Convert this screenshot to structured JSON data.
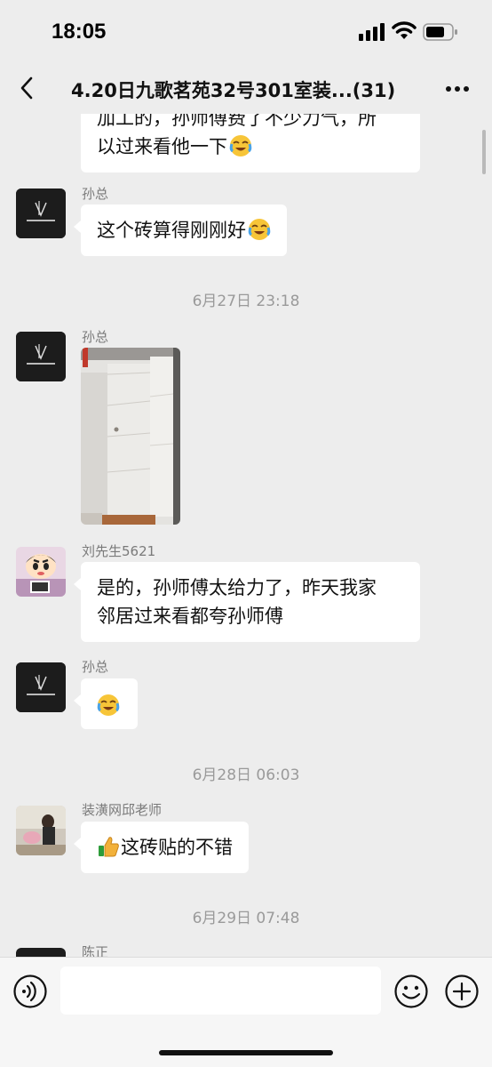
{
  "status_bar": {
    "time": "18:05",
    "icons": [
      "signal-icon",
      "wifi-icon",
      "battery-icon"
    ]
  },
  "nav": {
    "back_icon": "chevron-left-icon",
    "title": "4.20日九歌茗苑32号301室装...(31)",
    "more_icon": "more-dots-icon"
  },
  "messages": [
    {
      "type": "text",
      "sender": "",
      "lines": [
        "加工的，孙师傅费了不少力气，所",
        "以过来看他一下"
      ],
      "emoji": "crying-laughing"
    },
    {
      "type": "text",
      "sender": "孙总",
      "avatar": "company-logo-avatar",
      "lines": [
        "这个砖算得刚刚好"
      ],
      "emoji": "crying-laughing"
    },
    {
      "type": "timestamp",
      "text": "6月27日 23:18"
    },
    {
      "type": "image",
      "sender": "孙总",
      "avatar": "company-logo-avatar",
      "image": "bathroom-tile-photo"
    },
    {
      "type": "text",
      "sender": "刘先生5621",
      "avatar": "cartoon-avatar",
      "lines": [
        "是的，孙师傅太给力了，昨天我家",
        "邻居过来看都夸孙师傅"
      ]
    },
    {
      "type": "text",
      "sender": "孙总",
      "avatar": "company-logo-avatar",
      "lines": [
        ""
      ],
      "emoji": "crying-laughing"
    },
    {
      "type": "timestamp",
      "text": "6月28日 06:03"
    },
    {
      "type": "text",
      "sender": "装潢网邱老师",
      "avatar": "photo-avatar",
      "lines": [
        "这砖贴的不错"
      ],
      "lead_emoji": "thumbs-up"
    },
    {
      "type": "timestamp",
      "text": "6月29日 07:48"
    },
    {
      "type": "partial",
      "sender": "陈正"
    }
  ],
  "input_bar": {
    "voice_icon": "voice-icon",
    "placeholder": "",
    "emoji_icon": "emoji-icon",
    "plus_icon": "plus-icon"
  },
  "colors": {
    "background": "#ededed",
    "bubble": "#ffffff",
    "meta_text": "#9a9a9a"
  }
}
